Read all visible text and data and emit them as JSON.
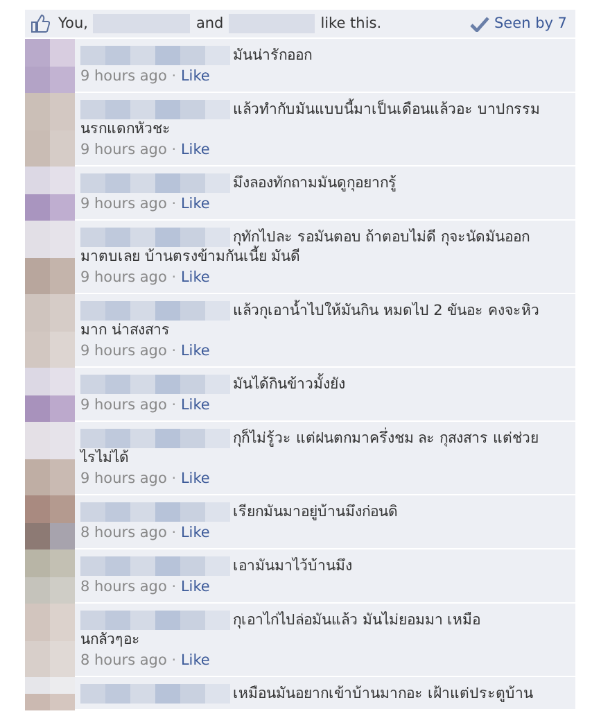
{
  "like_bar": {
    "prefix": "You,",
    "joiner": "and",
    "suffix": "like this.",
    "seen": "Seen by 7"
  },
  "comments": [
    {
      "lines": [
        "มันน่ารักออก"
      ],
      "time": "9 hours ago",
      "dot": "·",
      "like": "Like"
    },
    {
      "lines": [
        "แล้วทำกับมันแบบนี้มาเป็นเดือนแล้วอะ บาปกรรม",
        "นรกแดกหัวชะ"
      ],
      "time": "9 hours ago",
      "dot": "·",
      "like": "Like"
    },
    {
      "lines": [
        "มึงลองทักถามมันดูกุอยากรู้"
      ],
      "time": "9 hours ago",
      "dot": "·",
      "like": "Like"
    },
    {
      "lines": [
        "กุทักไปละ รอมันตอบ ถ้าตอบไม่ดี กุจะนัดมันออก",
        "มาตบเลย บ้านตรงข้ามกันเนี้ย มันดี"
      ],
      "time": "9 hours ago",
      "dot": "·",
      "like": "Like"
    },
    {
      "lines": [
        "แล้วกุเอาน้ำไปให้มันกิน หมดไป 2 ขันอะ คงจะหิว",
        "มาก น่าสงสาร"
      ],
      "time": "9 hours ago",
      "dot": "·",
      "like": "Like"
    },
    {
      "lines": [
        "มันได้กินข้าวมั้งยัง"
      ],
      "time": "9 hours ago",
      "dot": "·",
      "like": "Like"
    },
    {
      "lines": [
        "กุก็ไม่รู้วะ แต่ฝนตกมาครึ่งชม ละ กุสงสาร แต่ช่วย",
        "ไรไม่ได้"
      ],
      "time": "9 hours ago",
      "dot": "·",
      "like": "Like"
    },
    {
      "lines": [
        "เรียกมันมาอยู่บ้านมึงก่อนดิ"
      ],
      "time": "8 hours ago",
      "dot": "·",
      "like": "Like"
    },
    {
      "lines": [
        "เอามันมาไว้บ้านมึง"
      ],
      "time": "8 hours ago",
      "dot": "·",
      "like": "Like"
    },
    {
      "lines": [
        "กุเอาไก่ไปล่อมันแล้ว มันไม่ยอมมา เหมือ",
        "นกลัวๆอะ"
      ],
      "time": "8 hours ago",
      "dot": "·",
      "like": "Like"
    },
    {
      "lines": [
        "เหมือนมันอยากเข้าบ้านมากอะ เฝ้าแต่ประตูบ้าน"
      ]
    }
  ]
}
